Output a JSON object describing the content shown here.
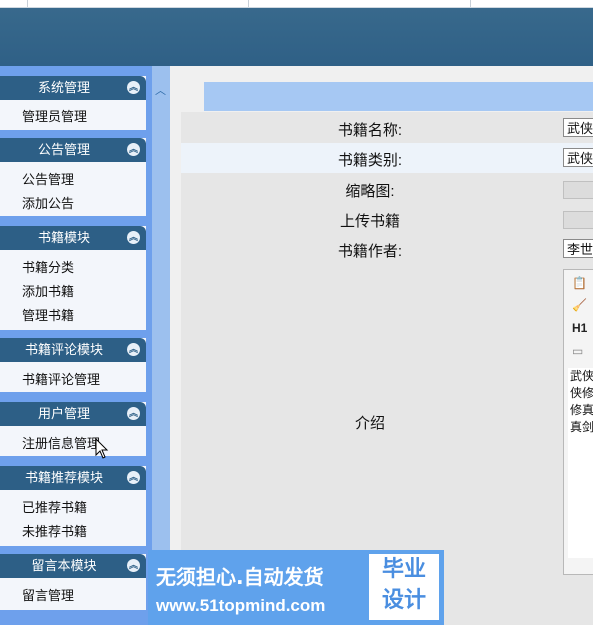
{
  "sidebar": {
    "groups": [
      {
        "title": "系统管理",
        "items": [
          "管理员管理"
        ]
      },
      {
        "title": "公告管理",
        "items": [
          "公告管理",
          "添加公告"
        ]
      },
      {
        "title": "书籍模块",
        "items": [
          "书籍分类",
          "添加书籍",
          "管理书籍"
        ]
      },
      {
        "title": "书籍评论模块",
        "items": [
          "书籍评论管理"
        ]
      },
      {
        "title": "用户管理",
        "items": [
          "注册信息管理"
        ]
      },
      {
        "title": "书籍推荐模块",
        "items": [
          "已推荐书籍",
          "未推荐书籍"
        ]
      },
      {
        "title": "留言本模块",
        "items": [
          "留言管理"
        ]
      }
    ],
    "collapse_icon": "double-chevron-up-icon"
  },
  "form": {
    "book_name": {
      "label": "书籍名称:",
      "value": "武侠"
    },
    "book_category": {
      "label": "书籍类别:",
      "value": "武侠"
    },
    "thumbnail": {
      "label": "缩略图:"
    },
    "upload": {
      "label": "上传书籍"
    },
    "author": {
      "label": "书籍作者:",
      "value": "李世"
    },
    "intro": {
      "label": "介绍"
    }
  },
  "editor": {
    "toolbar_h1": "H1",
    "content_lines": [
      "武侠",
      "侠修",
      "修真",
      "真剑"
    ]
  },
  "badge": {
    "line1": "无须担心.自动发货",
    "line2": "www.51topmind.com",
    "box_line1": "毕业",
    "box_line2": "设计"
  }
}
